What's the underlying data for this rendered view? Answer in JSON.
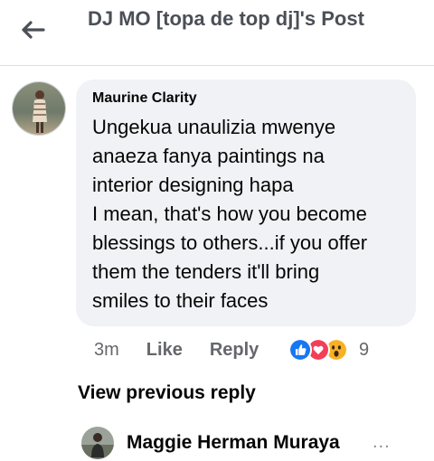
{
  "header": {
    "title": "DJ MO [topa de top dj]'s Post",
    "back_icon": "arrow-left-icon"
  },
  "comment": {
    "author": "Maurine Clarity",
    "text_lines": [
      "Ungekua unaulizia mwenye",
      "anaeza fanya paintings na",
      "interior designing hapa",
      "I mean, that's how you become",
      "blessings to others...if you offer",
      "them the tenders it'll bring",
      "smiles to their faces"
    ],
    "time": "3m",
    "like_label": "Like",
    "reply_label": "Reply",
    "reactions": [
      "like-reaction-icon",
      "love-reaction-icon",
      "wow-reaction-icon"
    ],
    "reaction_count": "9"
  },
  "view_previous_reply": "View previous reply",
  "reply": {
    "author": "Maggie Herman Muraya",
    "more_label": "..."
  },
  "colors": {
    "bubble": "#f0f2f5",
    "secondary_text": "#65676b",
    "like_blue": "#1877f2",
    "love_red": "#f33e58",
    "wow_yellow": "#f7b125"
  }
}
